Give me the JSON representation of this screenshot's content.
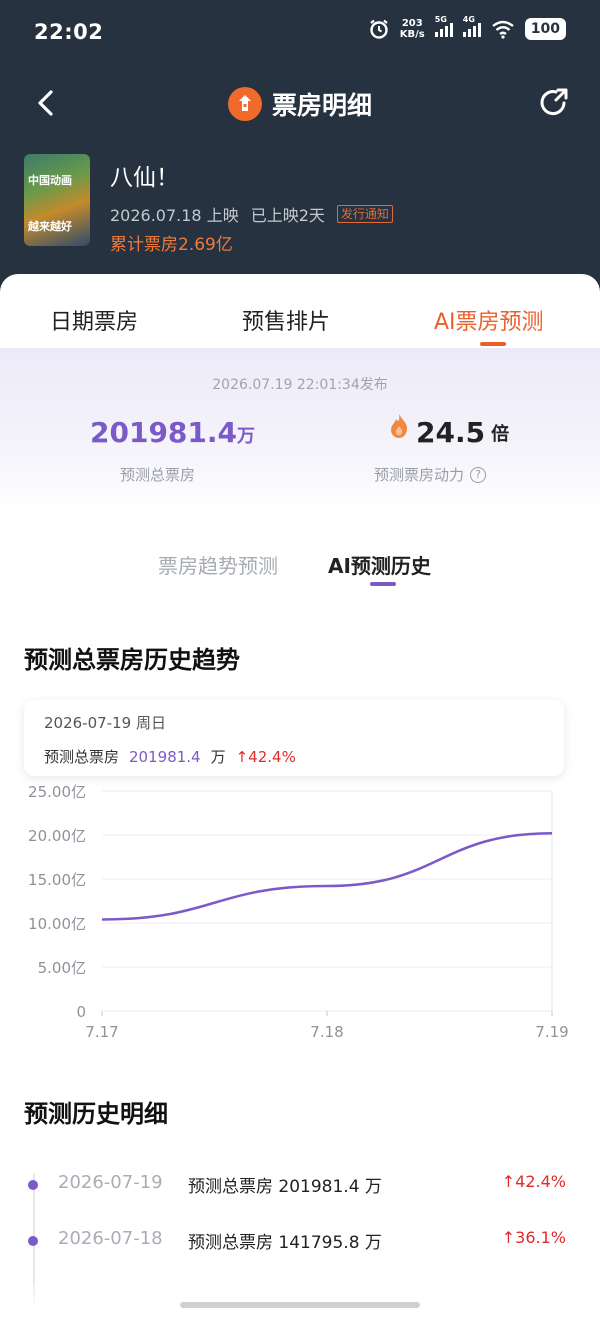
{
  "status_bar": {
    "time": "22:02",
    "net_speed": "203",
    "net_unit": "KB/s",
    "sig1_label": "5G",
    "sig2_label": "4G",
    "battery": "100"
  },
  "nav": {
    "title": "票房明细"
  },
  "movie": {
    "name": "八仙！",
    "poster_line1": "中国动画",
    "poster_line2": "越来越好",
    "release": "2026.07.18 上映",
    "days": "已上映2天",
    "tag": "发行通知",
    "total_box": "累计票房2.69亿"
  },
  "tabs": [
    {
      "label": "日期票房"
    },
    {
      "label": "预售排片"
    },
    {
      "label": "AI票房预测"
    }
  ],
  "summary": {
    "published": "2026.07.19 22:01:34发布",
    "forecast_value": "201981.4",
    "forecast_unit": "万",
    "forecast_label": "预测总票房",
    "momentum_value": "24.5",
    "momentum_unit": "倍",
    "momentum_label": "预测票房动力"
  },
  "subtabs": [
    {
      "label": "票房趋势预测"
    },
    {
      "label": "AI预测历史"
    }
  ],
  "trend_title": "预测总票房历史趋势",
  "tooltip": {
    "date": "2026-07-19  周日",
    "label": "预测总票房",
    "value": "201981.4",
    "unit": "万",
    "change": "↑42.4%"
  },
  "chart_data": {
    "type": "line",
    "x": [
      "7.17",
      "7.18",
      "7.19"
    ],
    "series": [
      {
        "values": [
          10.4,
          14.2,
          20.2
        ],
        "color": "#7b5ac8"
      }
    ],
    "yticks": [
      "0",
      "5.00亿",
      "10.00亿",
      "15.00亿",
      "20.00亿",
      "25.00亿"
    ],
    "ylim": [
      0,
      25
    ],
    "grid": true
  },
  "detail_title": "预测历史明细",
  "history": [
    {
      "date": "2026-07-19",
      "desc": "预测总票房 201981.4 万",
      "change": "↑42.4%"
    },
    {
      "date": "2026-07-18",
      "desc": "预测总票房 141795.8 万",
      "change": "↑36.1%"
    }
  ]
}
